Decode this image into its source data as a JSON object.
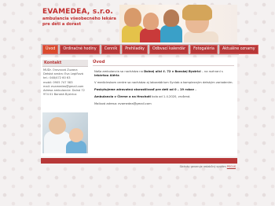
{
  "brand": {
    "name": "EVAMEDEA, s.r.o.",
    "sub1": "ambulancia všeobecného lekára",
    "sub2": "pre deti a dorast"
  },
  "nav": [
    {
      "label": "Úvod",
      "active": true
    },
    {
      "label": "Ordinačné hodiny"
    },
    {
      "label": "Cenník"
    },
    {
      "label": "Prehliadky"
    },
    {
      "label": "Odbvací kalendár"
    },
    {
      "label": "Fotogaléria"
    },
    {
      "label": "Aktuálne oznamy"
    }
  ],
  "sidebar": {
    "title": "Kontakt",
    "lines": [
      "MUDr. Oravcová Zuzana",
      "Detská sestra: Eva Legíňová",
      "tel.: 048/472 60 63",
      "mobil: 0905 747 583",
      "mail: evamedea@gmail.com",
      "Adresa ambulancie: Dolná 72",
      "974 01 Banská Bystrica"
    ]
  },
  "main": {
    "title": "Úvod",
    "p1a": "Naša ambulancia sa nachádza na ",
    "p1b": "Dolnej ulici č. 72 v Banskej Bystrici",
    "p1c": " – na rozhraní s ",
    "p1d": "lekárňou Aléria",
    "p2": "V medicínskom centre sa nachádza aj laboratórium Synlab a komplexným detským zariadením.",
    "p3": "Poskytujeme zdravotnú starostlivosť pre deti od 0 – 19 rokov .",
    "p4a": "Ambulancia v Čierne a na Hrochoti",
    "p4b": " bola od 1.4.2020, zrušená.",
    "p5": "Mailová adresa: evamedea@gmail.com"
  },
  "footer": {
    "text": "Stránky generuje redakčný systém ",
    "link": "PECUS"
  }
}
